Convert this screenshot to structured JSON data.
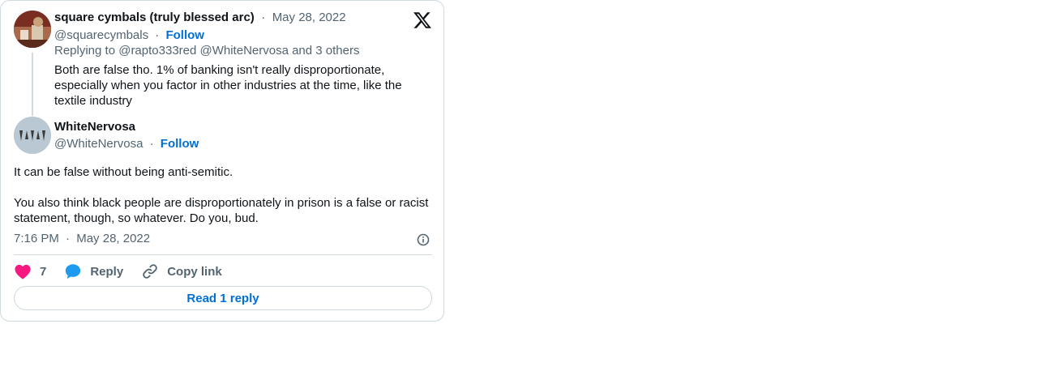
{
  "parent_tweet": {
    "author_name": "square cymbals (truly blessed arc)",
    "date": "May 28, 2022",
    "handle": "@squarecymbals",
    "follow_label": "Follow",
    "replying_to": "Replying to @rapto333red @WhiteNervosa and 3 others",
    "text": "Both are false tho. 1% of banking isn't really disproportionate, especially when you factor in other industries at the time, like the textile industry"
  },
  "main_tweet": {
    "author_name": "WhiteNervosa",
    "handle": "@WhiteNervosa",
    "follow_label": "Follow",
    "text_p1": "It can be false without being anti-semitic.",
    "text_p2": "You also think black people are disproportionately in prison is a false or racist statement, though, so whatever. Do you, bud.",
    "time": "7:16 PM",
    "date": "May 28, 2022"
  },
  "actions": {
    "like_count": "7",
    "reply_label": "Reply",
    "copy_link_label": "Copy link"
  },
  "read_replies_label": "Read 1 reply",
  "separator": "·",
  "colors": {
    "link_blue": "#006fd6",
    "like_pink": "#f91880",
    "reply_blue": "#1d9bf0",
    "muted_text": "#536471",
    "border": "#cfd9de"
  },
  "icons": [
    "x-logo-icon",
    "heart-icon",
    "reply-bubble-icon",
    "link-icon",
    "info-icon"
  ]
}
